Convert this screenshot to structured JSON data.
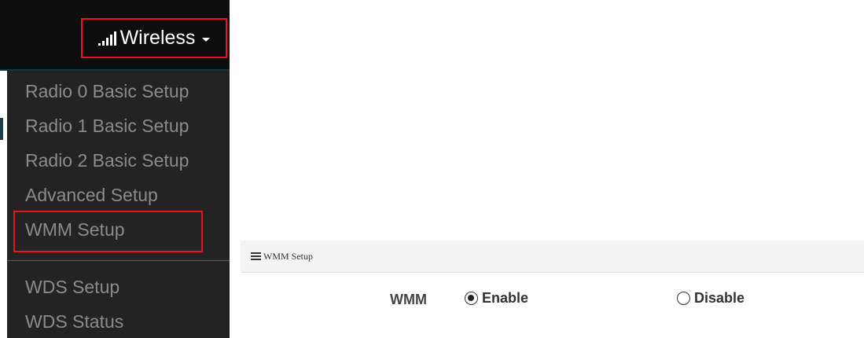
{
  "nav": {
    "wireless_label": "Wireless",
    "signal_icon": "signal-bars-icon",
    "caret_icon": "caret-down-icon"
  },
  "dropdown": {
    "items": [
      "Radio 0 Basic Setup",
      "Radio 1 Basic Setup",
      "Radio 2 Basic Setup",
      "Advanced Setup",
      "WMM Setup",
      "WDS Setup",
      "WDS Status"
    ],
    "highlighted": "WMM Setup"
  },
  "panel": {
    "title": "WMM Setup",
    "title_icon": "list-icon",
    "field_label": "WMM",
    "options": [
      "Enable",
      "Disable"
    ],
    "selected": "Enable"
  },
  "colors": {
    "highlight_border": "#e8141b",
    "navbar_bg": "#0d0d0d",
    "dropdown_bg": "#232323",
    "dropdown_text": "#8b8b8b"
  }
}
